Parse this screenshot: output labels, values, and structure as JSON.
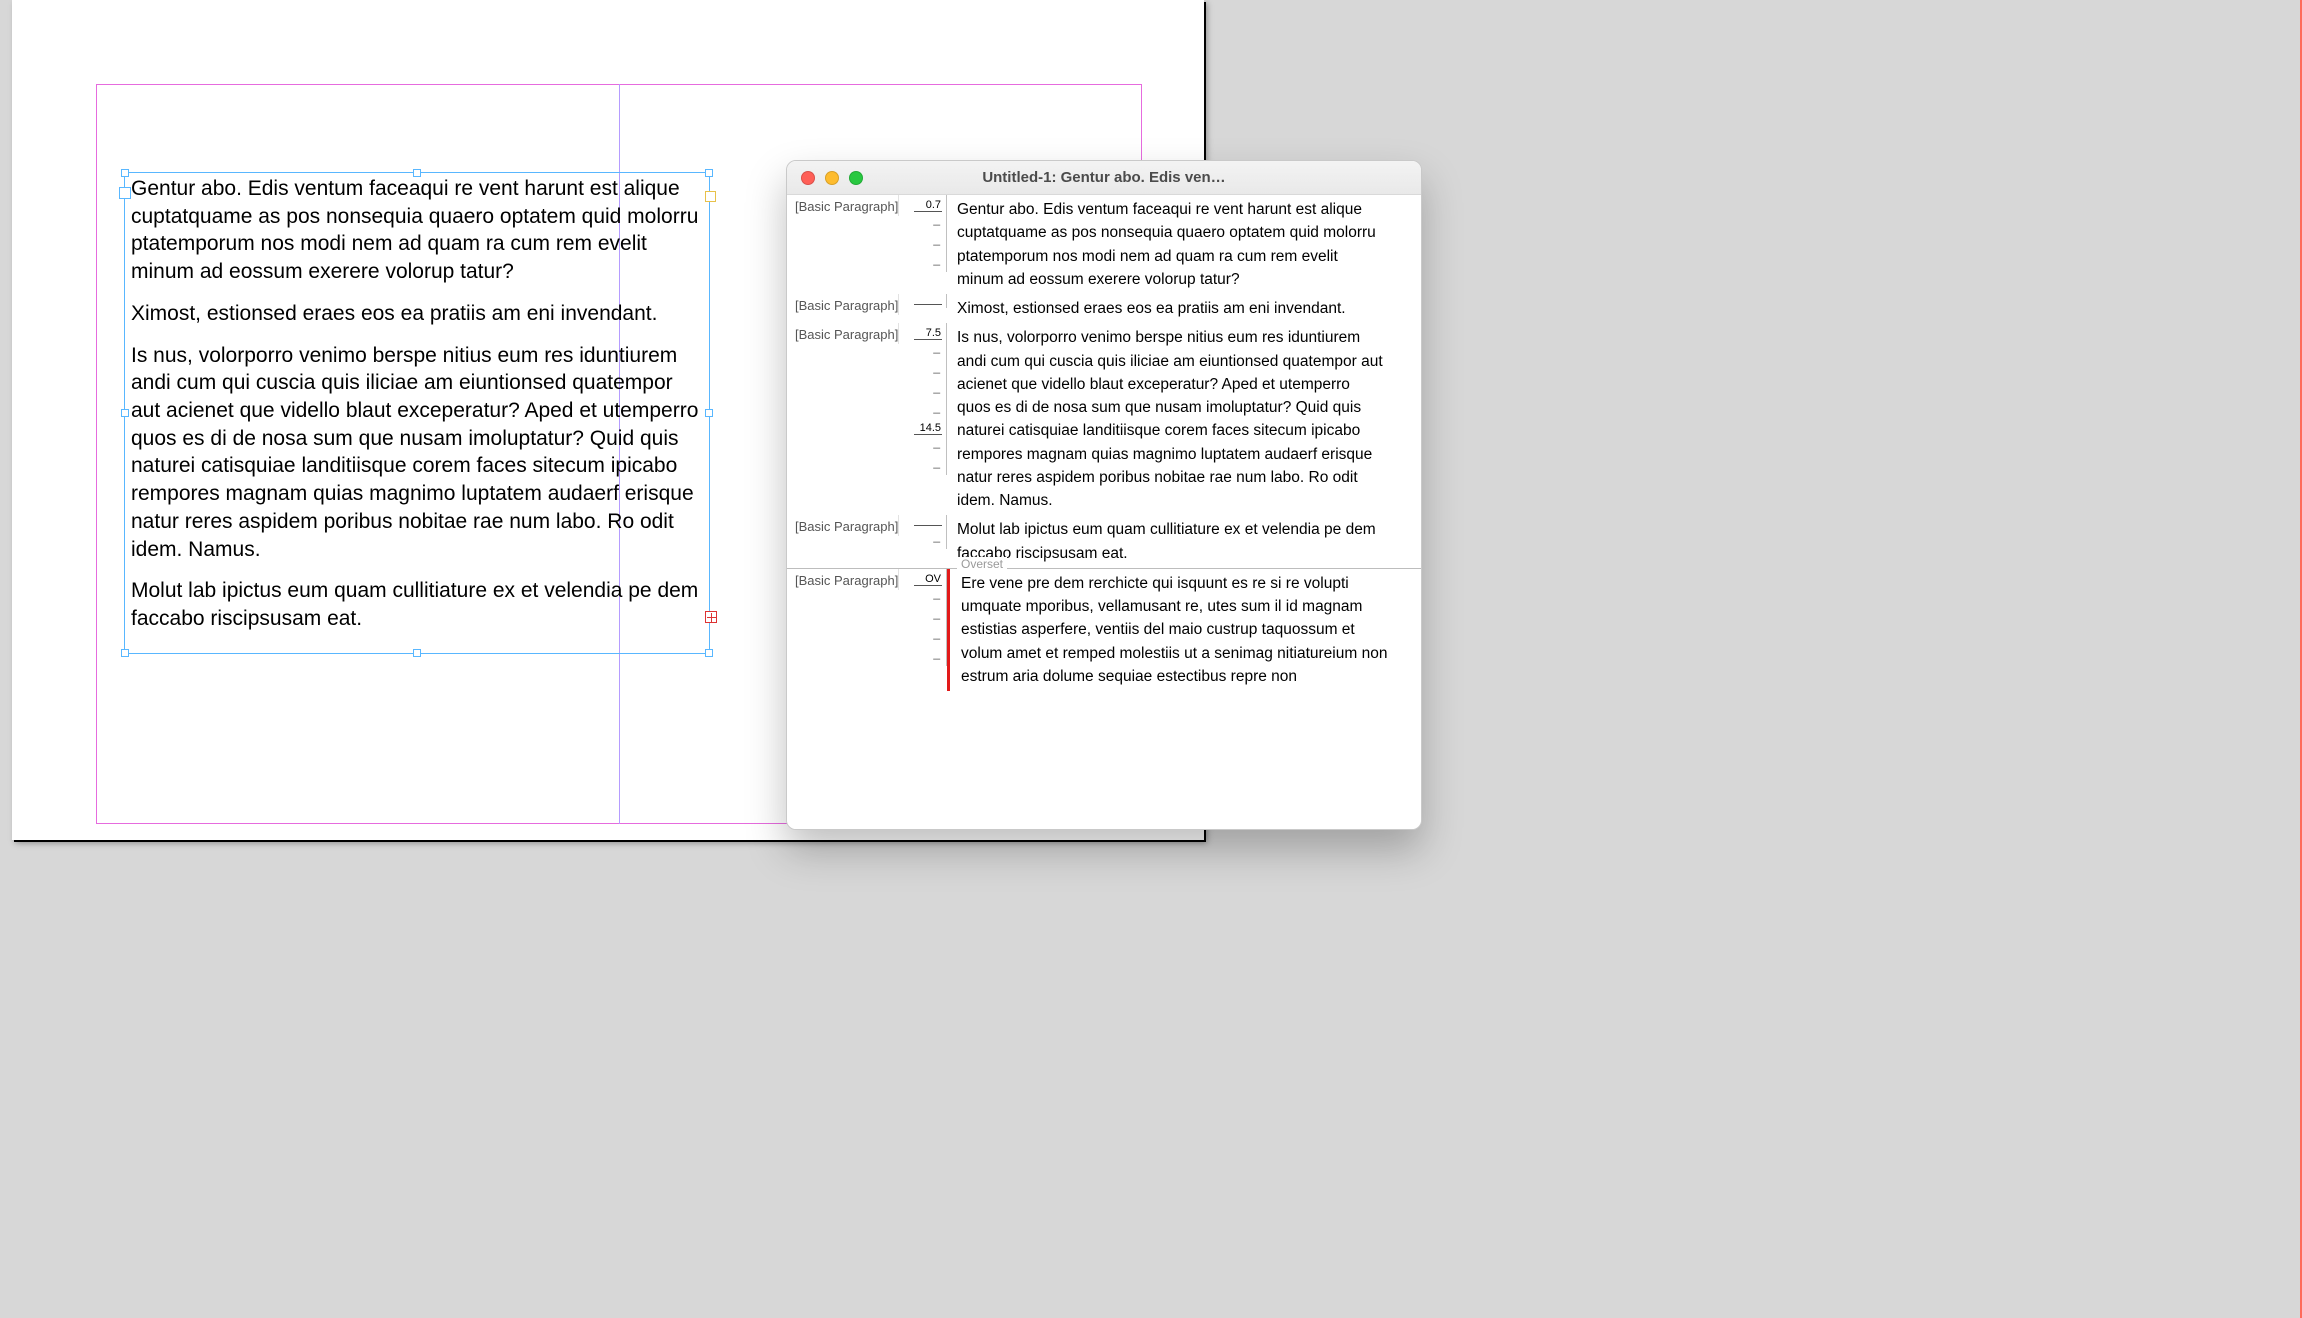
{
  "colors": {
    "margin_guide": "#e66bde",
    "frame_selection": "#59b7ff",
    "overset_red": "#e21a1a"
  },
  "page_text_frame": {
    "paragraphs": [
      "Gentur abo. Edis ventum faceaqui re vent harunt est alique cuptatquame as pos nonsequia quaero optatem quid molorru ptatemporum nos modi nem ad quam ra cum rem evelit minum ad eossum exerere volorup tatur?",
      "Ximost, estionsed eraes eos ea pratiis am eni invendant.",
      "Is nus, volorporro venimo berspe nitius eum res iduntiurem andi cum qui cuscia quis iliciae am eiuntionsed quatempor aut acienet que vidello blaut exceperatur? Aped et utemperro quos es di de nosa sum que nusam imoluptatur? Quid quis naturei catisquiae landitiisque corem faces sitecum ipicabo rempores magnam quias magnimo luptatem audaerf erisque natur reres aspidem poribus nobitae rae num labo. Ro odit idem. Namus.",
      "Molut lab ipictus eum quam cullitiature ex et velendia pe dem faccabo riscipsusam eat."
    ]
  },
  "story_editor": {
    "window_title": "Untitled-1: Gentur abo. Edis ven…",
    "overset_label": "Overset",
    "style_label": "[Basic Paragraph]",
    "paragraphs": [
      {
        "style": "[Basic Paragraph]",
        "info": "0.7",
        "lines": [
          "Gentur abo. Edis ventum faceaqui re vent harunt est alique",
          "cuptatquame as pos nonsequia quaero optatem quid molorru",
          "ptatemporum nos modi nem ad quam ra cum rem evelit",
          "minum ad eossum exerere volorup tatur?"
        ]
      },
      {
        "style": "[Basic Paragraph]",
        "info": "",
        "lines": [
          "Ximost, estionsed eraes eos ea pratiis am eni invendant."
        ]
      },
      {
        "style": "[Basic Paragraph]",
        "info": "7.5",
        "info2": "14.5",
        "info2_at_line": 5,
        "lines": [
          "Is nus, volorporro venimo berspe nitius eum res iduntiurem",
          "andi cum qui cuscia quis iliciae am eiuntionsed quatempor aut",
          "acienet que vidello blaut exceperatur? Aped et utemperro",
          "quos es di de nosa sum que nusam imoluptatur? Quid quis",
          "naturei catisquiae landitiisque corem faces sitecum ipicabo",
          "rempores magnam quias magnimo luptatem audaerf erisque",
          "natur reres aspidem poribus nobitae rae num labo. Ro odit",
          "idem. Namus."
        ]
      },
      {
        "style": "[Basic Paragraph]",
        "info": "",
        "lines": [
          "Molut lab ipictus eum quam cullitiature ex et velendia pe dem",
          "faccabo riscipsusam eat."
        ]
      },
      {
        "style": "[Basic Paragraph]",
        "info": "OV",
        "overset": true,
        "lines": [
          "Ere vene pre dem rerchicte qui isquunt es re si re volupti",
          "umquate mporibus, vellamusant re, utes sum il id magnam",
          "estistias asperfere, ventiis del maio custrup taquossum et",
          "volum amet et remped molestiis ut a senimag nitiatureium non",
          "estrum aria dolume sequiae estectibus repre non"
        ]
      }
    ]
  }
}
